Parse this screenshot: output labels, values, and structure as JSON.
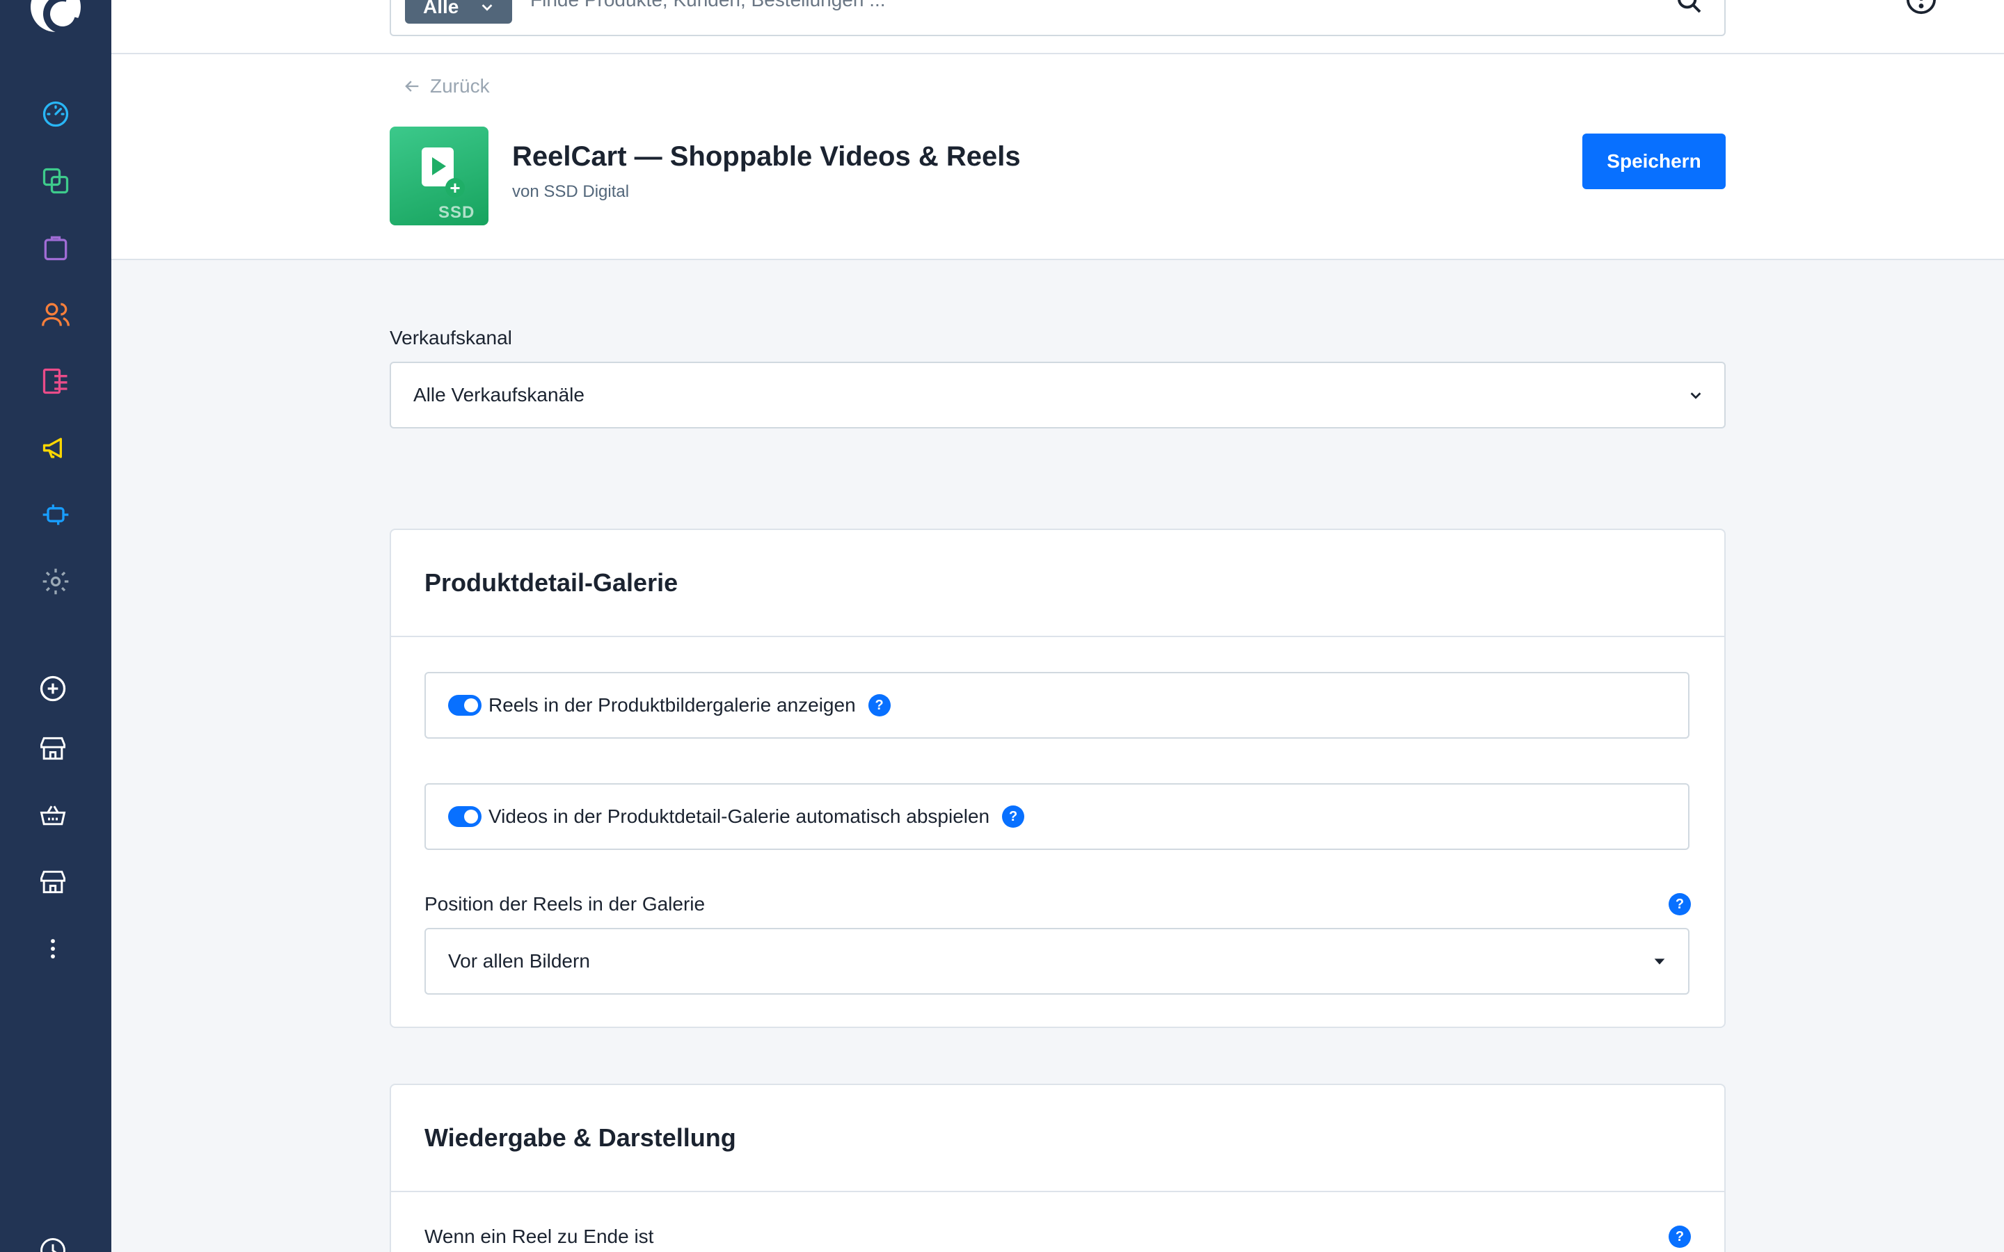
{
  "topbar": {
    "search_scope": "Alle",
    "search_placeholder": "Finde Produkte, Kunden, Bestellungen ..."
  },
  "sidebar": {
    "icons": [
      {
        "name": "dashboard-icon",
        "color": "#29b6f6"
      },
      {
        "name": "catalog-icon",
        "color": "#3ecb8c"
      },
      {
        "name": "orders-icon",
        "color": "#a06cd5"
      },
      {
        "name": "customers-icon",
        "color": "#f77f3b"
      },
      {
        "name": "content-icon",
        "color": "#ea4c89"
      },
      {
        "name": "marketing-icon",
        "color": "#ffd700"
      },
      {
        "name": "extensions-icon",
        "color": "#189eff"
      },
      {
        "name": "settings-icon",
        "color": "#9aa8b5"
      },
      {
        "name": "add-sales-channel-icon",
        "color": "#ffffff"
      },
      {
        "name": "storefront-icon",
        "color": "#ffffff"
      },
      {
        "name": "basket-icon",
        "color": "#ffffff"
      },
      {
        "name": "storefront-icon-2",
        "color": "#ffffff"
      },
      {
        "name": "more-icon",
        "color": "#ffffff"
      }
    ]
  },
  "header": {
    "back_label": "Zurück",
    "app_title": "ReelCart — Shoppable Videos & Reels",
    "app_vendor": "von SSD Digital",
    "app_logo_text": "SSD",
    "save_label": "Speichern"
  },
  "sales_channel": {
    "label": "Verkaufskanal",
    "value": "Alle Verkaufskanäle"
  },
  "gallery_card": {
    "title": "Produktdetail-Galerie",
    "toggle1_label": "Reels in der Produktbildergalerie anzeigen",
    "toggle1_on": true,
    "toggle2_label": "Videos in der Produktdetail-Galerie automatisch abspielen",
    "toggle2_on": true,
    "position_label": "Position der Reels in der Galerie",
    "position_value": "Vor allen Bildern"
  },
  "playback_card": {
    "title": "Wiedergabe & Darstellung",
    "end_label": "Wenn ein Reel zu Ende ist"
  },
  "help_glyph": "?",
  "colors": {
    "sidebar_bg": "#223454",
    "primary": "#0870ff",
    "page_bg": "#f4f6f9"
  }
}
